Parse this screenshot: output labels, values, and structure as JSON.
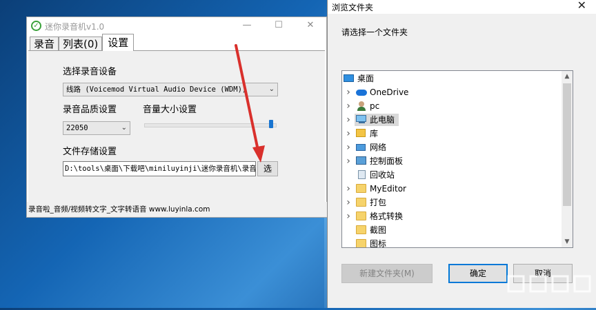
{
  "recorder": {
    "title": "迷你录音机v1.0",
    "tabs": [
      {
        "label": "录音"
      },
      {
        "label": "列表(0)"
      },
      {
        "label": "设置"
      }
    ],
    "device": {
      "label": "选择录音设备",
      "value": "线路 (Voicemod Virtual Audio Device (WDM))"
    },
    "quality": {
      "label": "录音品质设置",
      "value": "22050"
    },
    "volume": {
      "label": "音量大小设置",
      "level": 0.97
    },
    "storage": {
      "label": "文件存储设置",
      "path": "D:\\tools\\桌面\\下载吧\\miniluyinji\\迷你录音机\\录音",
      "browse_label": "选"
    },
    "status": "录音啦_音频/视频转文字_文字转语音 www.luyinla.com"
  },
  "dialog": {
    "title": "浏览文件夹",
    "close": "✕",
    "prompt": "请选择一个文件夹",
    "tree": [
      {
        "label": "桌面",
        "icon": "desktop-icon",
        "expandable": false
      },
      {
        "label": "OneDrive",
        "icon": "cloud-icon",
        "expandable": true
      },
      {
        "label": "pc",
        "icon": "user-icon",
        "expandable": true
      },
      {
        "label": "此电脑",
        "icon": "computer-icon",
        "expandable": true
      },
      {
        "label": "库",
        "icon": "library-icon",
        "expandable": true
      },
      {
        "label": "网络",
        "icon": "network-icon",
        "expandable": true
      },
      {
        "label": "控制面板",
        "icon": "control-panel-icon",
        "expandable": true
      },
      {
        "label": "回收站",
        "icon": "recycle-bin-icon",
        "expandable": false
      },
      {
        "label": "MyEditor",
        "icon": "folder-icon",
        "expandable": true
      },
      {
        "label": "打包",
        "icon": "folder-icon",
        "expandable": true
      },
      {
        "label": "格式转换",
        "icon": "folder-icon",
        "expandable": true
      },
      {
        "label": "截图",
        "icon": "folder-icon",
        "expandable": false
      },
      {
        "label": "图标",
        "icon": "folder-icon",
        "expandable": false
      }
    ],
    "selected_index": 3,
    "buttons": {
      "new_folder": "新建文件夹(M)",
      "ok": "确定",
      "cancel": "取消"
    }
  },
  "colors": {
    "accent": "#0078d7",
    "annotation_arrow": "#d9302c"
  }
}
